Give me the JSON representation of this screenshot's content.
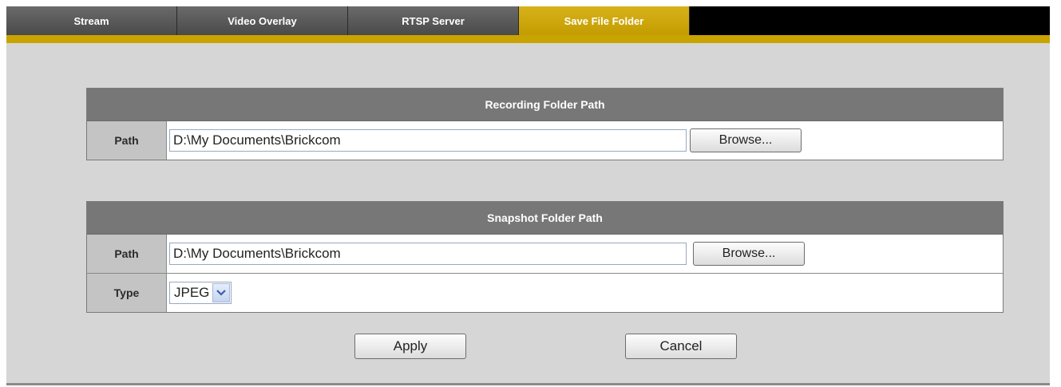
{
  "tabs": [
    {
      "label": "Stream",
      "active": false
    },
    {
      "label": "Video Overlay",
      "active": false
    },
    {
      "label": "RTSP Server",
      "active": false
    },
    {
      "label": "Save File Folder",
      "active": true
    }
  ],
  "recording": {
    "title": "Recording Folder Path",
    "path_label": "Path",
    "path_value": "D:\\My Documents\\Brickcom",
    "browse_label": "Browse..."
  },
  "snapshot": {
    "title": "Snapshot Folder Path",
    "path_label": "Path",
    "path_value": "D:\\My Documents\\Brickcom",
    "browse_label": "Browse...",
    "type_label": "Type",
    "type_value": "JPEG"
  },
  "actions": {
    "apply_label": "Apply",
    "cancel_label": "Cancel"
  },
  "colors": {
    "active_tab": "#c9a300",
    "inactive_tab": "#555555",
    "section_header": "#777777",
    "panel_bg": "#d6d6d6",
    "label_bg": "#c4c4c4"
  },
  "icons": {
    "type_dropdown": "chevron-down-icon"
  }
}
